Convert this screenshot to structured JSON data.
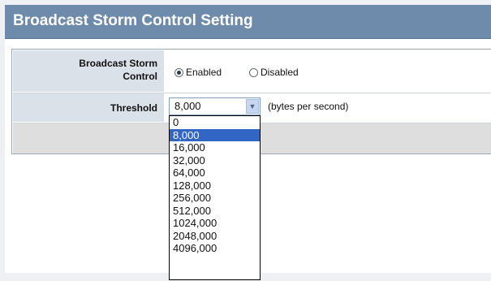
{
  "header": {
    "title": "Broadcast Storm Control Setting"
  },
  "form": {
    "broadcast_storm": {
      "label": "Broadcast Storm Control",
      "label_line1": "Broadcast Storm",
      "label_line2": "Control",
      "options": [
        "Enabled",
        "Disabled"
      ],
      "selected": "Enabled"
    },
    "threshold": {
      "label": "Threshold",
      "value": "8,000",
      "unit": "(bytes per second)",
      "dropdown_open": true,
      "options": [
        "0",
        "8,000",
        "16,000",
        "32,000",
        "64,000",
        "128,000",
        "256,000",
        "512,000",
        "1024,000",
        "2048,000",
        "4096,000"
      ],
      "selected_index": 1
    }
  },
  "colors": {
    "title_bar": "#6f8bac",
    "label_cell": "#dbe1e8",
    "selected_option": "#3166c5"
  },
  "icons": {
    "dropdown_arrow": "chevron-down-icon",
    "radio": "radio-icon"
  }
}
